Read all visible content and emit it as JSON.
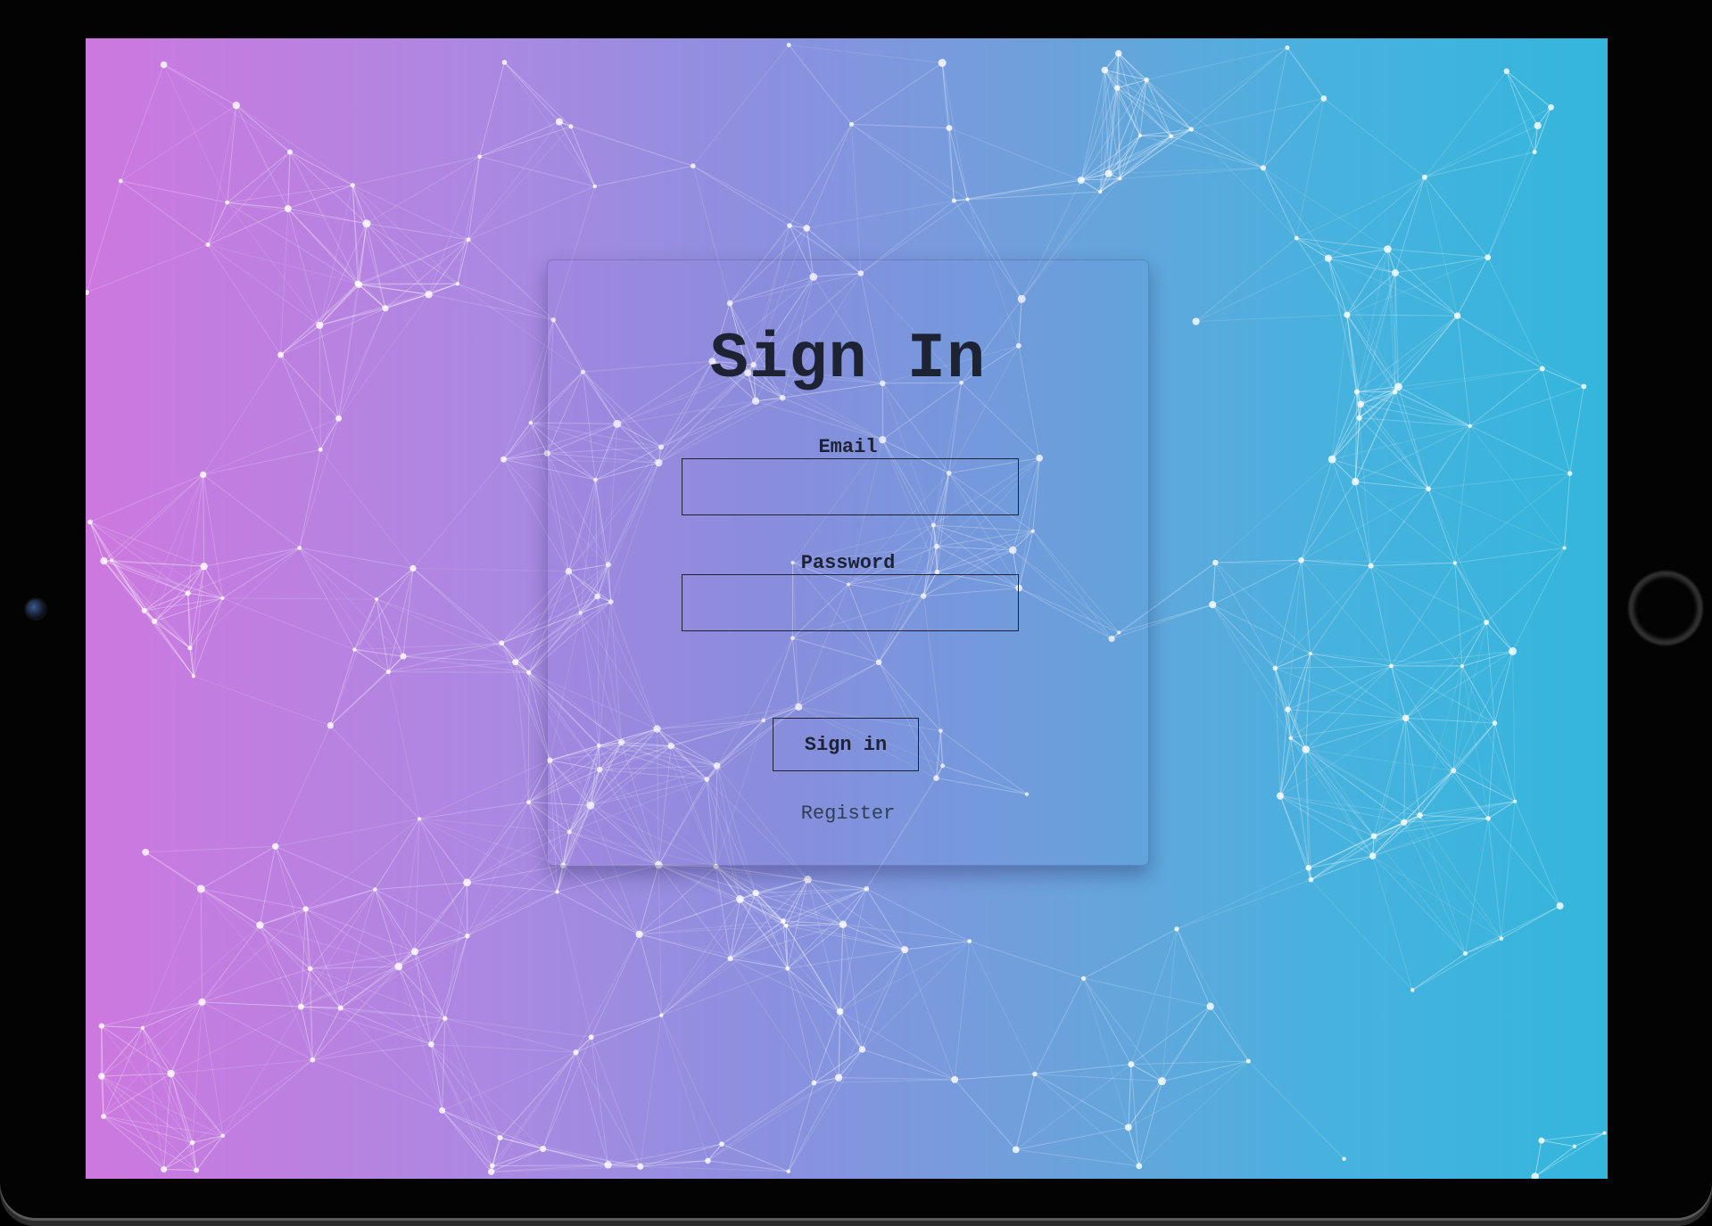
{
  "login": {
    "title": "Sign In",
    "email_label": "Email",
    "email_value": "",
    "password_label": "Password",
    "password_value": "",
    "signin_label": "Sign in",
    "register_label": "Register"
  },
  "colors": {
    "gradient_left": "#cd78df",
    "gradient_right": "#34b6dc",
    "text": "#1d2333",
    "network_lines": "#ffffff"
  },
  "icons": {
    "camera": "front-camera-icon",
    "home": "home-button-icon"
  }
}
